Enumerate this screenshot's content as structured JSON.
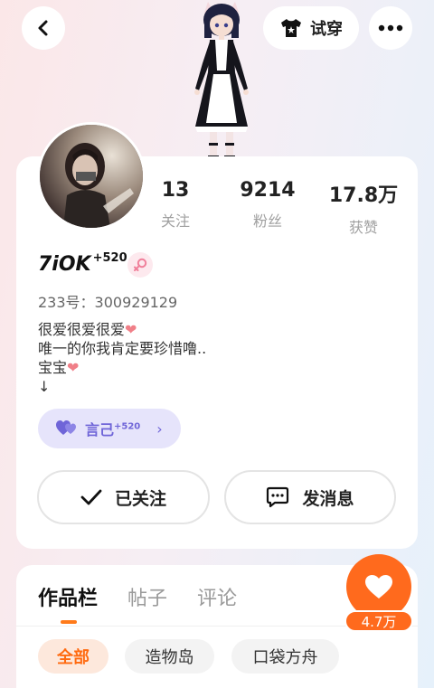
{
  "topbar": {
    "tryon_label": "试穿"
  },
  "stats": [
    {
      "value": "13",
      "label": "关注"
    },
    {
      "value": "9214",
      "label": "粉丝"
    },
    {
      "value": "17.8万",
      "label": "获赞"
    }
  ],
  "profile": {
    "username": "7iOK",
    "username_sup": "+520",
    "uid": "233号：300929129",
    "bio": [
      "很爱很爱很爱",
      "唯一的你我肯定要珍惜噜..",
      "宝宝",
      "↓"
    ],
    "heart": "❤"
  },
  "tag": {
    "name": "言己",
    "sup": "+520",
    "chevron": "›"
  },
  "actions": {
    "follow_label": "已关注",
    "message_label": "发消息"
  },
  "tabs": [
    "作品栏",
    "帖子",
    "评论"
  ],
  "chips": [
    "全部",
    "造物岛",
    "口袋方舟"
  ],
  "likes": {
    "count": "4.7万"
  },
  "colors": {
    "accent": "#ff6a1d",
    "tag": "#6f65d8"
  },
  "icons": {
    "back": "chevron-left-icon",
    "tryon": "shirt-icon",
    "more": "more-icon",
    "gender": "female-icon",
    "follow": "check-icon",
    "message": "chat-icon",
    "like": "heart-icon"
  }
}
